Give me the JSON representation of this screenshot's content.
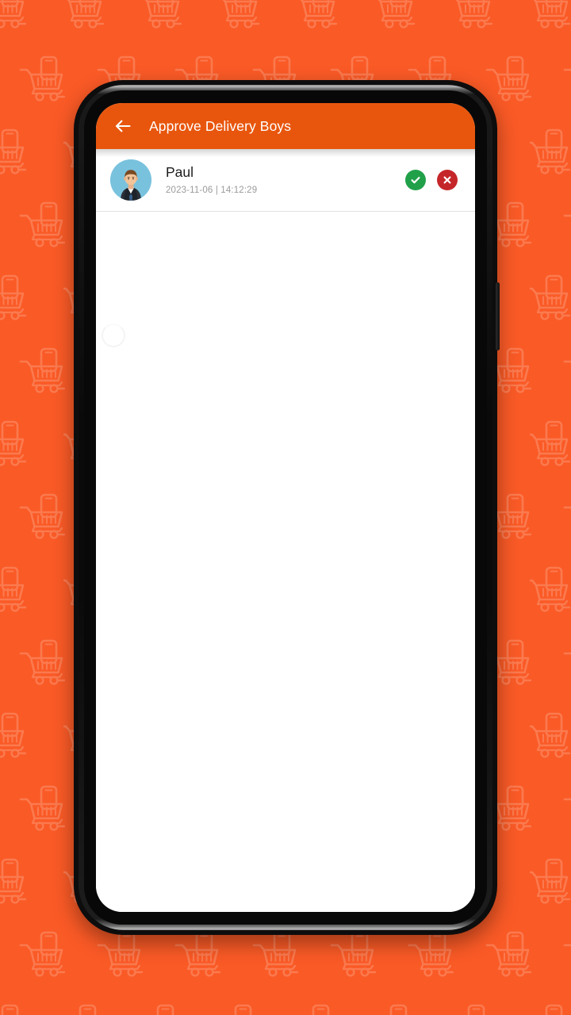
{
  "backdrop": {
    "color": "#fa5a26",
    "pattern_icon": "shopping-cart-with-phone-icon",
    "pattern_color": "#fb7a4f"
  },
  "device": {
    "frame_color": "#0d0d0d",
    "side_button": "power-button"
  },
  "app": {
    "appbar": {
      "title": "Approve Delivery Boys",
      "background_color": "#e8560d",
      "title_color": "#ffffff",
      "back_icon": "arrow-left-icon"
    },
    "list": {
      "items": [
        {
          "name": "Paul",
          "date": "2023-11-06 | 14:12:29",
          "avatar_icon": "user-avatar-businessman",
          "approve_icon": "check-circle-icon",
          "reject_icon": "close-circle-icon",
          "approve_color": "#21a04a",
          "reject_color": "#c5262a"
        }
      ]
    },
    "loading": {
      "spinner_icon": "loading-spinner-icon"
    }
  }
}
